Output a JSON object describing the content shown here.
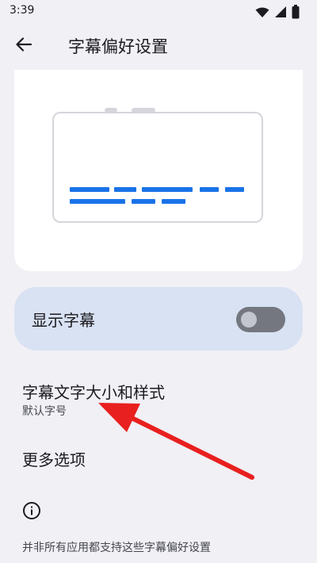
{
  "status_bar": {
    "time": "3:39",
    "icons": [
      "wifi-icon",
      "signal-icon",
      "battery-icon"
    ]
  },
  "app_bar": {
    "back_icon": "arrow-back-icon",
    "title": "字幕偏好设置"
  },
  "preview": {
    "caption_color": "#1A73E8"
  },
  "show_captions": {
    "label": "显示字幕",
    "enabled": false
  },
  "items": [
    {
      "title": "字幕文字大小和样式",
      "subtitle": "默认字号"
    },
    {
      "title": "更多选项"
    }
  ],
  "footer": {
    "icon": "info-icon",
    "note": "并非所有应用都支持这些字幕偏好设置"
  },
  "annotation": {
    "arrow_color": "#E8201F"
  }
}
